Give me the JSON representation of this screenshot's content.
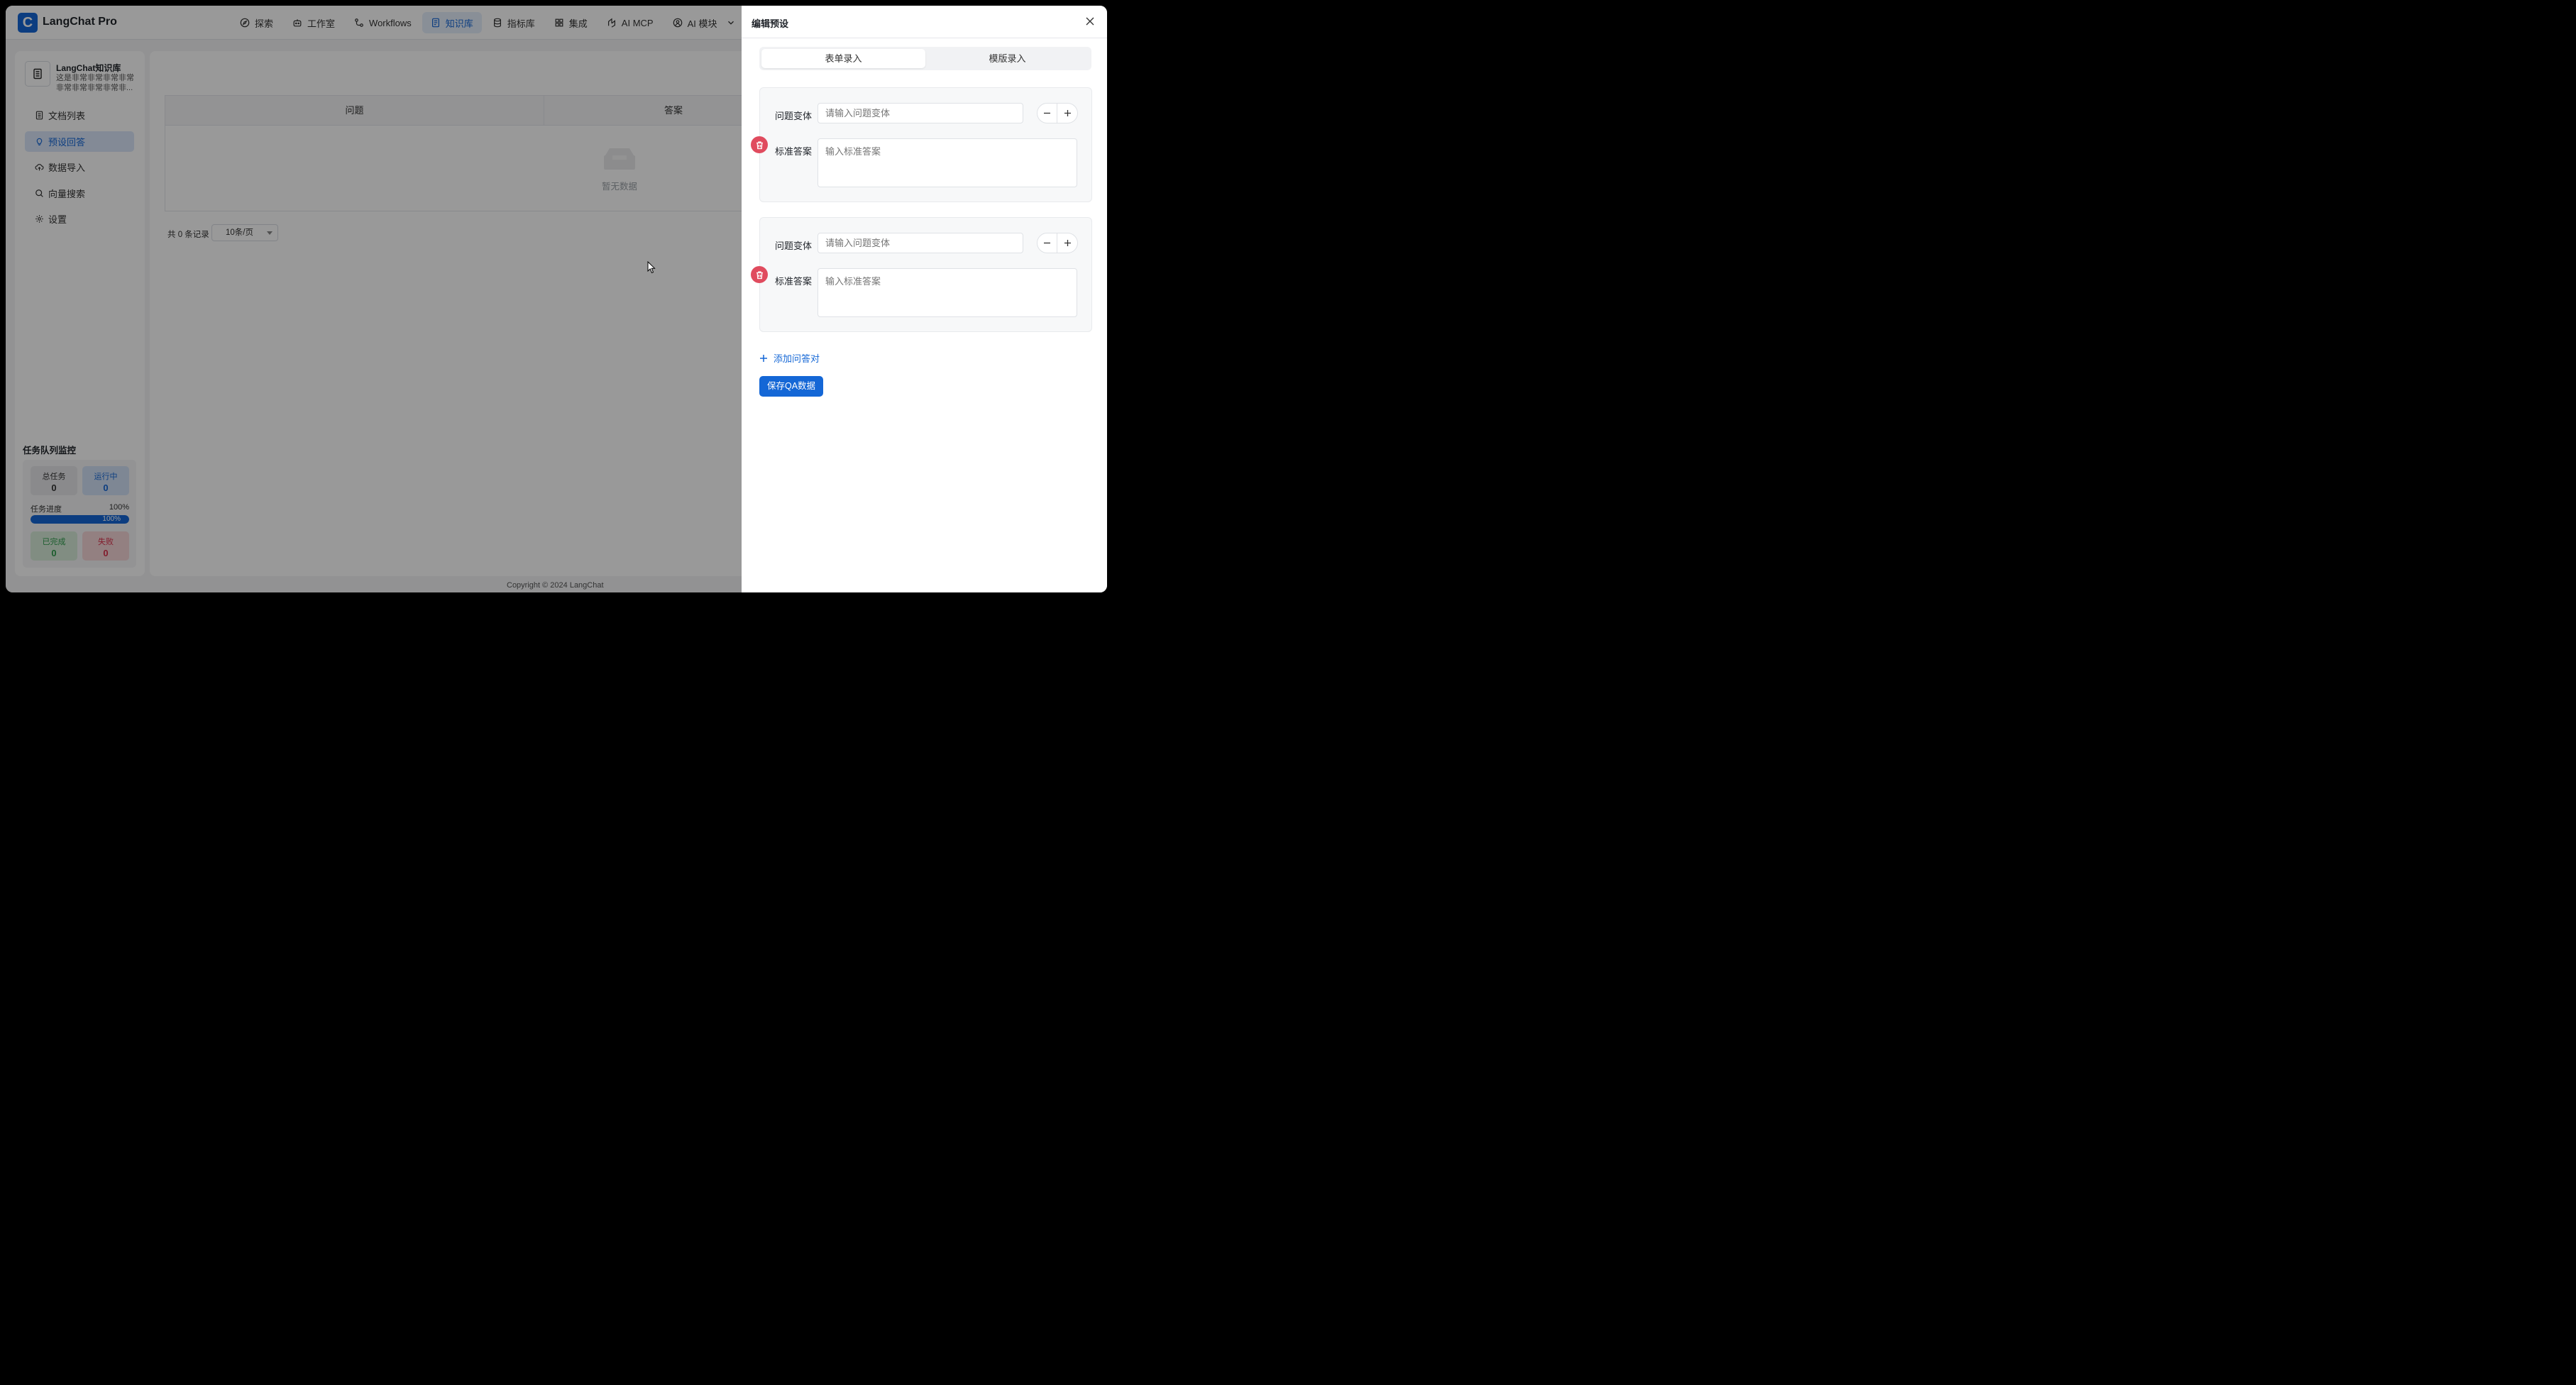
{
  "brand": {
    "logo_letter": "C",
    "name": "LangChat Pro"
  },
  "nav": [
    {
      "label": "探索",
      "icon": "compass-icon"
    },
    {
      "label": "工作室",
      "icon": "robot-icon"
    },
    {
      "label": "Workflows",
      "icon": "workflow-icon"
    },
    {
      "label": "知识库",
      "icon": "book-icon",
      "active": true
    },
    {
      "label": "指标库",
      "icon": "database-icon"
    },
    {
      "label": "集成",
      "icon": "grid-icon"
    },
    {
      "label": "AI MCP",
      "icon": "mcp-icon"
    },
    {
      "label": "AI 模块",
      "icon": "module-icon"
    }
  ],
  "knowledge_base": {
    "name": "LangChat知识库",
    "description": "这是非常非常非常非常非常非常非常非常非..."
  },
  "menu": [
    {
      "label": "文档列表",
      "icon": "document-list-icon"
    },
    {
      "label": "预设回答",
      "icon": "lightbulb-icon",
      "active": true
    },
    {
      "label": "数据导入",
      "icon": "cloud-upload-icon"
    },
    {
      "label": "向量搜索",
      "icon": "search-icon"
    },
    {
      "label": "设置",
      "icon": "gear-icon"
    }
  ],
  "queue": {
    "title": "任务队列监控",
    "total_label": "总任务",
    "total": "0",
    "running_label": "运行中",
    "running": "0",
    "progress_label": "任务进度",
    "progress_text": "100%",
    "progress_value": 1.0,
    "done_label": "已完成",
    "done": "0",
    "failed_label": "失败",
    "failed": "0"
  },
  "table": {
    "columns": [
      "问题",
      "答案"
    ],
    "empty_text": "暂无数据",
    "total_text": "共 0 条记录",
    "page_size": "10条/页"
  },
  "footer": "Copyright © 2024 LangChat",
  "drawer": {
    "title": "编辑预设",
    "tabs": [
      {
        "label": "表单录入",
        "active": true
      },
      {
        "label": "模版录入"
      }
    ],
    "pairs": [
      {
        "question_label": "问题变体",
        "question_placeholder": "请输入问题变体",
        "answer_label": "标准答案",
        "answer_placeholder": "输入标准答案"
      },
      {
        "question_label": "问题变体",
        "question_placeholder": "请输入问题变体",
        "answer_label": "标准答案",
        "answer_placeholder": "输入标准答案"
      }
    ],
    "add_label": "添加问答对",
    "save_label": "保存QA数据"
  },
  "colors": {
    "accent": "#1467d6",
    "danger": "#e04b5e",
    "success": "#2e9b4b"
  }
}
